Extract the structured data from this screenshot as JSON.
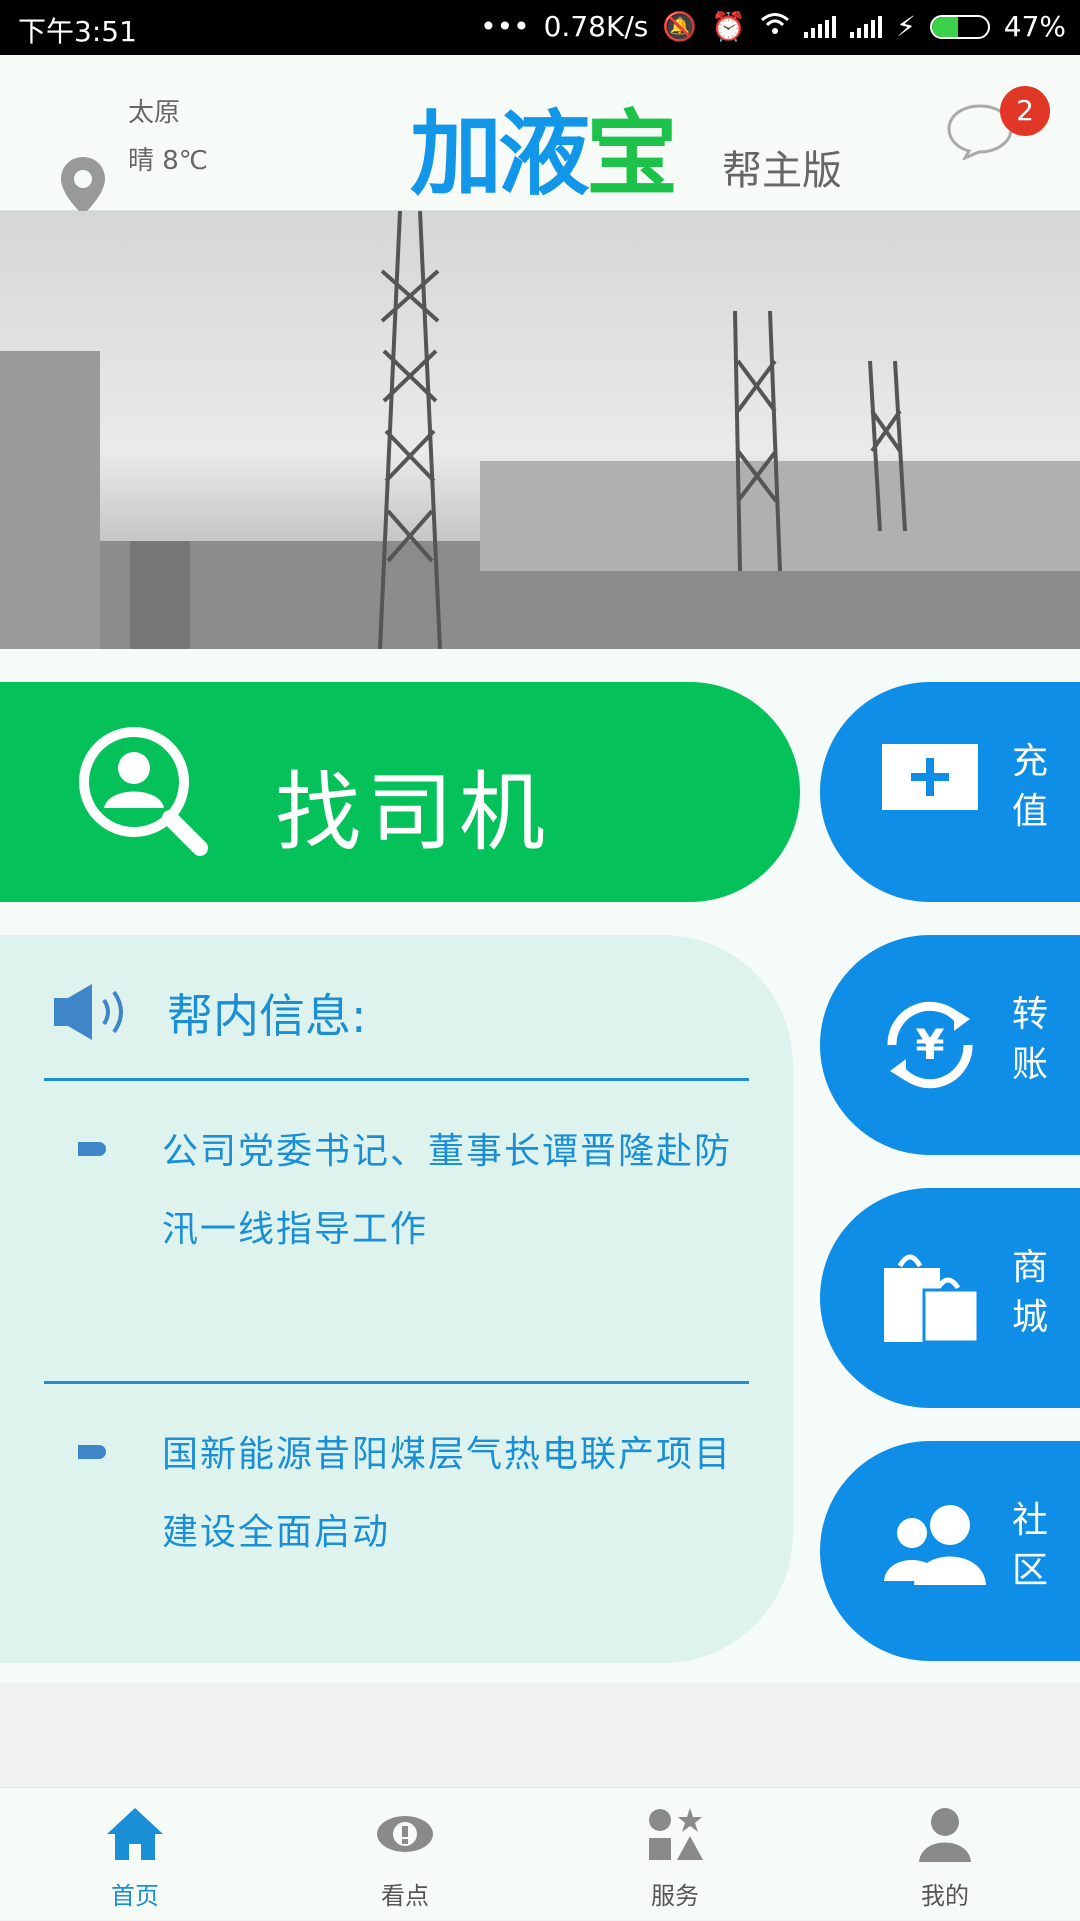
{
  "status_bar": {
    "time": "下午3:51",
    "network_speed": "0.78K/s",
    "battery": "47%",
    "battery_level": 0.47,
    "icons": [
      "dots-icon",
      "mute-icon",
      "alarm-icon",
      "wifi-icon",
      "signal-icon",
      "signal-icon",
      "charging-icon",
      "battery-icon"
    ]
  },
  "header": {
    "city": "太原",
    "weather": "晴 8℃",
    "logo_main": "加液",
    "logo_accent": "宝",
    "edition": "帮主版",
    "message_badge": "2",
    "colors": {
      "brand_blue": "#1296e8",
      "brand_green": "#1cc24a",
      "badge_red": "#e13726"
    }
  },
  "banner": {
    "description_icon": "power-plant-photo"
  },
  "find_driver": {
    "label": "找司机"
  },
  "news": {
    "title": "帮内信息:",
    "items": [
      {
        "text": "公司党委书记、董事长谭晋隆赴防汛一线指导工作"
      },
      {
        "text": "国新能源昔阳煤层气热电联产项目建设全面启动"
      }
    ]
  },
  "side_buttons": [
    {
      "label": "充值",
      "icon": "plus-card-icon"
    },
    {
      "label": "转账",
      "icon": "yuan-transfer-icon"
    },
    {
      "label": "商城",
      "icon": "shopping-bag-icon"
    },
    {
      "label": "社区",
      "icon": "users-icon"
    }
  ],
  "tabs": [
    {
      "label": "首页",
      "icon": "home-icon",
      "active": true
    },
    {
      "label": "看点",
      "icon": "eye-icon",
      "active": false
    },
    {
      "label": "服务",
      "icon": "services-icon",
      "active": false
    },
    {
      "label": "我的",
      "icon": "person-icon",
      "active": false
    }
  ]
}
